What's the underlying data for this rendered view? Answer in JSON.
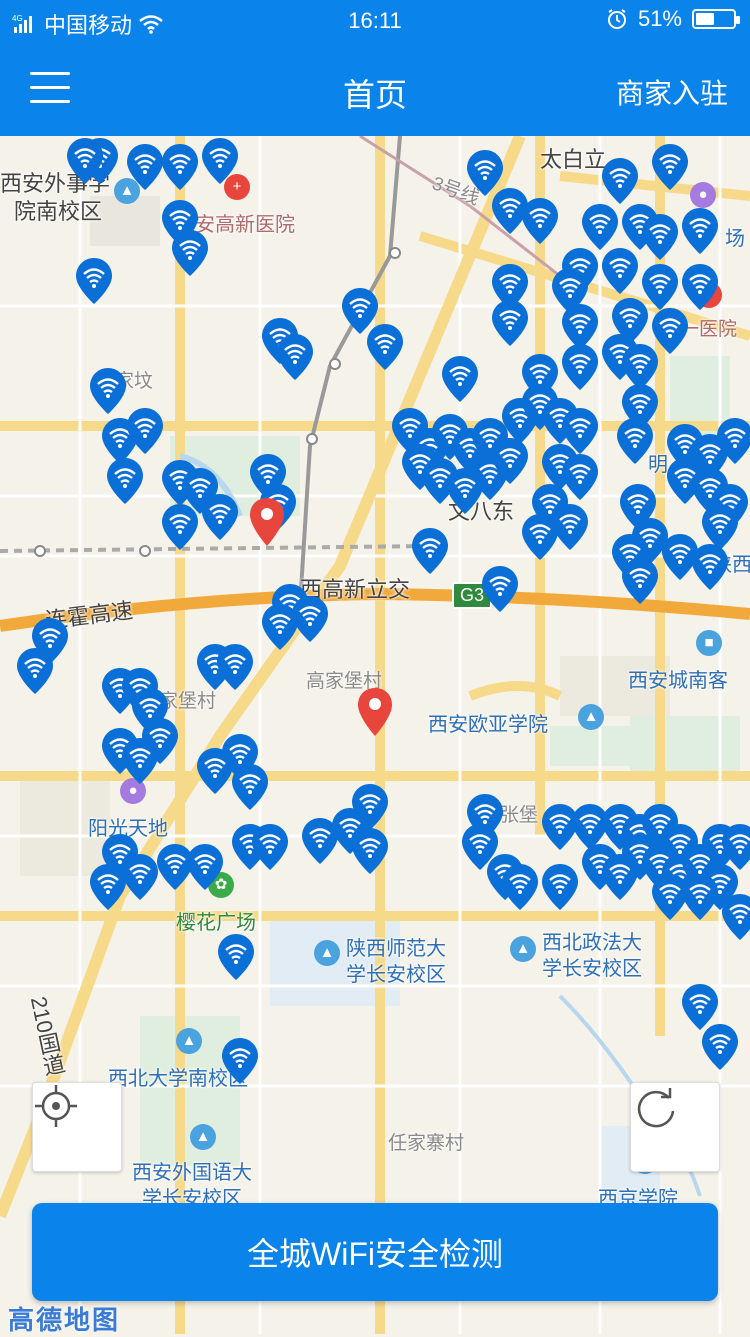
{
  "status_bar": {
    "carrier": "中国移动",
    "network": "4G",
    "time": "16:11",
    "battery_percent": "51%",
    "battery_level": 0.51,
    "icons": [
      "signal-icon",
      "wifi-icon",
      "alarm-icon",
      "battery-icon"
    ]
  },
  "header": {
    "title": "首页",
    "right_link": "商家入驻",
    "menu_icon": "hamburger-menu-icon",
    "bg_color": "#0a84ea"
  },
  "map": {
    "labels": {
      "l1": "西安外事学",
      "l2": "院南校区",
      "l3": "安高新医院",
      "l4": "太白立",
      "l5": "一医院",
      "l6": "场",
      "l7": "家坟",
      "l8": "文八东",
      "l9": "西高新立交",
      "l10": "连霍高速",
      "l11": "西安城南客",
      "l12": "高家堡村",
      "l13": "西安欧亚学院",
      "l14": "翟家堡村",
      "l15": "阳光天地",
      "l16": "张堡",
      "l17": "樱花广场",
      "l18": "陕西师范大",
      "l19": "学长安校区",
      "l20": "西北政法大",
      "l21": "学长安校区",
      "l22": "西北大学南校区",
      "l23": "任家寨村",
      "l24": "西安外国语大",
      "l25": "学长安校区",
      "l26": "西京学院",
      "l27": "210国道",
      "l28": "明",
      "l29": "陕西",
      "l30": "3号线"
    },
    "road_badge": "G3",
    "wifi_pin_color": "#0a6fd6",
    "location_pin_color": "#e8453c",
    "wifi_pin_icon": "wifi-location-pin-icon",
    "location_icon": "location-pin-icon"
  },
  "controls": {
    "locate_icon": "locate-crosshair-icon",
    "refresh_icon": "refresh-icon"
  },
  "action_button": {
    "label": "全城WiFi安全检测",
    "color": "#0a84ea"
  },
  "map_provider": "高德地图"
}
